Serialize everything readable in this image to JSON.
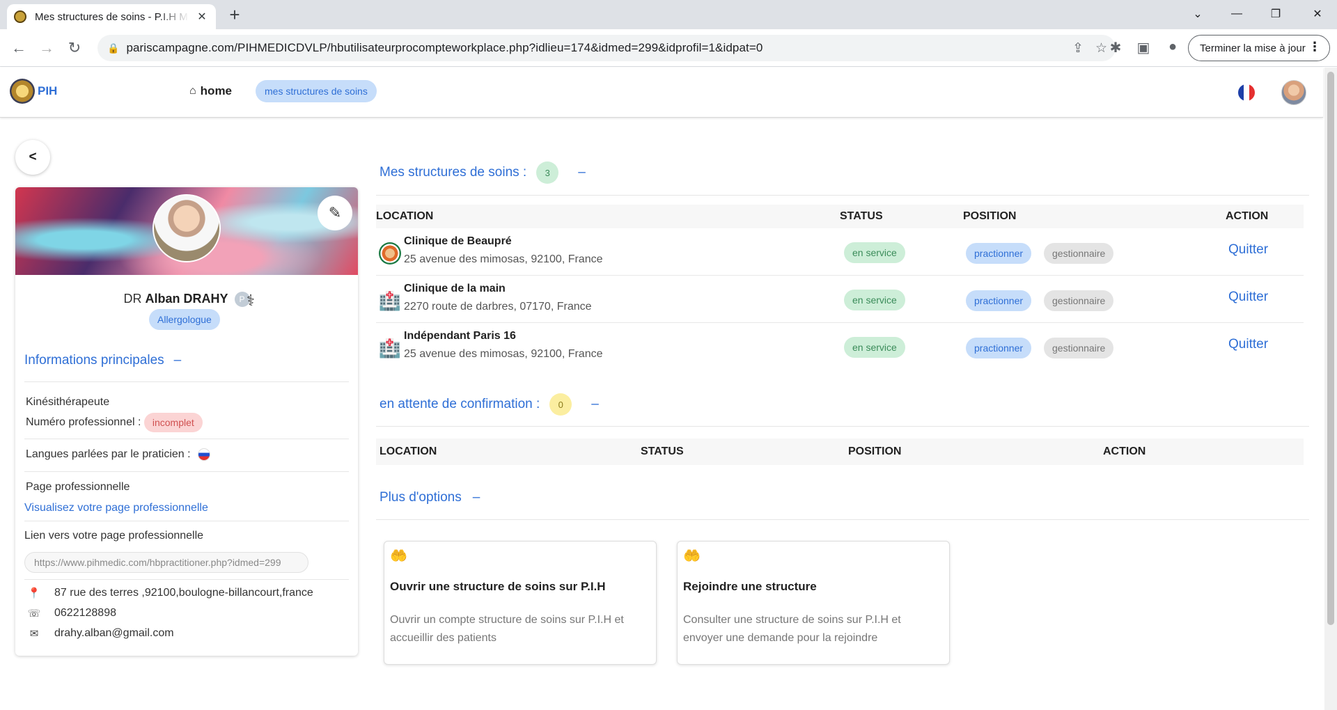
{
  "browser": {
    "tab_title": "Mes structures de soins - P.I.H M",
    "url": "pariscampagne.com/PIHMEDICDVLP/hbutilisateurprocompteworkplace.php?idlieu=174&idmed=299&idprofil=1&idpat=0",
    "update_button": "Terminer la mise à jour"
  },
  "header": {
    "brand": "PIH",
    "home_label": "home",
    "breadcrumb": "mes structures de soins"
  },
  "profile": {
    "back_label": "<",
    "title_prefix": "DR",
    "name": "Alban DRAHY",
    "p_badge": "P",
    "specialty": "Allergologue",
    "main_info_title": "Informations principales",
    "collapse": "–",
    "profession": "Kinésithérapeute",
    "pro_number_label": "Numéro professionnel :",
    "pro_number_status": "incomplet",
    "languages_label": "Langues parlées par le praticien :",
    "pro_page_label": "Page professionnelle",
    "pro_page_link": "Visualisez votre page professionnelle",
    "pro_link_label": "Lien vers votre page professionnelle",
    "pro_link_url": "https://www.pihmedic.com/hbpractitioner.php?idmed=299",
    "address": "87 rue des terres ,92100,boulogne-billancourt,france",
    "phone": "0622128898",
    "email": "drahy.alban@gmail.com"
  },
  "structures": {
    "title": "Mes structures de soins :",
    "count": "3",
    "collapse": "–",
    "columns": [
      "LOCATION",
      "STATUS",
      "POSITION",
      "ACTION"
    ],
    "rows": [
      {
        "name": "Clinique de Beaupré",
        "address": "25 avenue des mimosas, 92100, France",
        "status": "en service",
        "position1": "practionner",
        "position2": "gestionnaire",
        "action": "Quitter"
      },
      {
        "name": "Clinique de la main",
        "address": "2270 route de darbres, 07170, France",
        "status": "en service",
        "position1": "practionner",
        "position2": "gestionnaire",
        "action": "Quitter"
      },
      {
        "name": "Indépendant Paris 16",
        "address": "25 avenue des mimosas, 92100, France",
        "status": "en service",
        "position1": "practionner",
        "position2": "gestionnaire",
        "action": "Quitter"
      }
    ]
  },
  "pending": {
    "title": "en attente de confirmation :",
    "count": "0",
    "collapse": "–",
    "columns": [
      "LOCATION",
      "STATUS",
      "POSITION",
      "ACTION"
    ]
  },
  "options": {
    "title": "Plus d'options",
    "collapse": "–",
    "cards": [
      {
        "title": "Ouvrir une structure de soins sur P.I.H",
        "desc": "Ouvrir un compte structure de soins sur P.I.H et accueillir des patients"
      },
      {
        "title": "Rejoindre une structure",
        "desc": "Consulter une structure de soins sur P.I.H et envoyer une demande pour la rejoindre"
      }
    ]
  }
}
